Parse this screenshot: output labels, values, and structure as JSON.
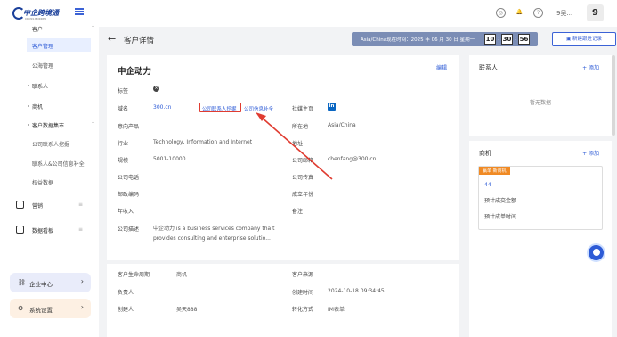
{
  "logo": {
    "text": "中企跨境通",
    "sub": "CROSS BORDER"
  },
  "sidebar": {
    "section_customer": "客户",
    "items": [
      {
        "label": "客户管理"
      },
      {
        "label": "公海管理"
      }
    ],
    "contacts": "联系人",
    "deals": "商机",
    "data_market": "客户数据集市",
    "data_items": [
      {
        "label": "公司联系人挖掘"
      },
      {
        "label": "联系人&公司信息补全"
      },
      {
        "label": "权益数据"
      }
    ],
    "marketing": "营销",
    "dashboard": "数据看板",
    "enterprise_center": "企业中心",
    "system_settings": "系统设置"
  },
  "topbar": {
    "user_name": "9吴...",
    "badge": "9"
  },
  "header": {
    "title": "客户详情",
    "clock_label": "Asia/China现在时间：2025 年 06 月 30 日 星期一",
    "hh": "10",
    "mm": "30",
    "ss": "56",
    "new_followup": "新建跟进记录"
  },
  "detail": {
    "company": "中企动力",
    "edit": "编辑",
    "tag_label": "标签",
    "domain_label": "域名",
    "domain_value": "300.cn",
    "find_contacts": "公司联系人挖掘",
    "company_info": "公司信息补全",
    "social_label": "社媒主页",
    "product_label": "意向产品",
    "location_label": "所在地",
    "location_value": "Asia/China",
    "industry_label": "行业",
    "industry_value": "Technology, Information and Internet",
    "address_label": "地址",
    "size_label": "规模",
    "size_value": "5001-10000",
    "email_label": "公司邮箱",
    "email_value": "chenfang@300.cn",
    "phone_label": "公司电话",
    "fax_label": "公司传真",
    "postcode_label": "邮政编码",
    "founded_label": "成立年份",
    "revenue_label": "年收入",
    "remark_label": "备注",
    "desc_label": "公司描述",
    "desc_value": "中企动力 is a business services company tha t provides consulting and enterprise solutio..."
  },
  "detail2": {
    "lifecycle_label": "客户生命周期",
    "lifecycle_value": "商机",
    "source_label": "客户来源",
    "owner_label": "负责人",
    "created_time_label": "创建时间",
    "created_time_value": "2024-10-18 09:34:45",
    "creator_label": "创建人",
    "creator_value": "吴天888",
    "convert_label": "转化方式",
    "convert_value": "IM表单"
  },
  "contacts_panel": {
    "title": "联系人",
    "add": "+ 添加",
    "empty": "暂无数据"
  },
  "deals_panel": {
    "title": "商机",
    "add": "+ 添加",
    "tag": "赢单 新商机",
    "deal_id": "44",
    "expected_amount": "预计成交金额",
    "expected_date": "预计成单时间"
  },
  "colors": {
    "accent": "#2d5bd6",
    "highlight": "#e03c31",
    "deal_tag": "#f08a24"
  }
}
